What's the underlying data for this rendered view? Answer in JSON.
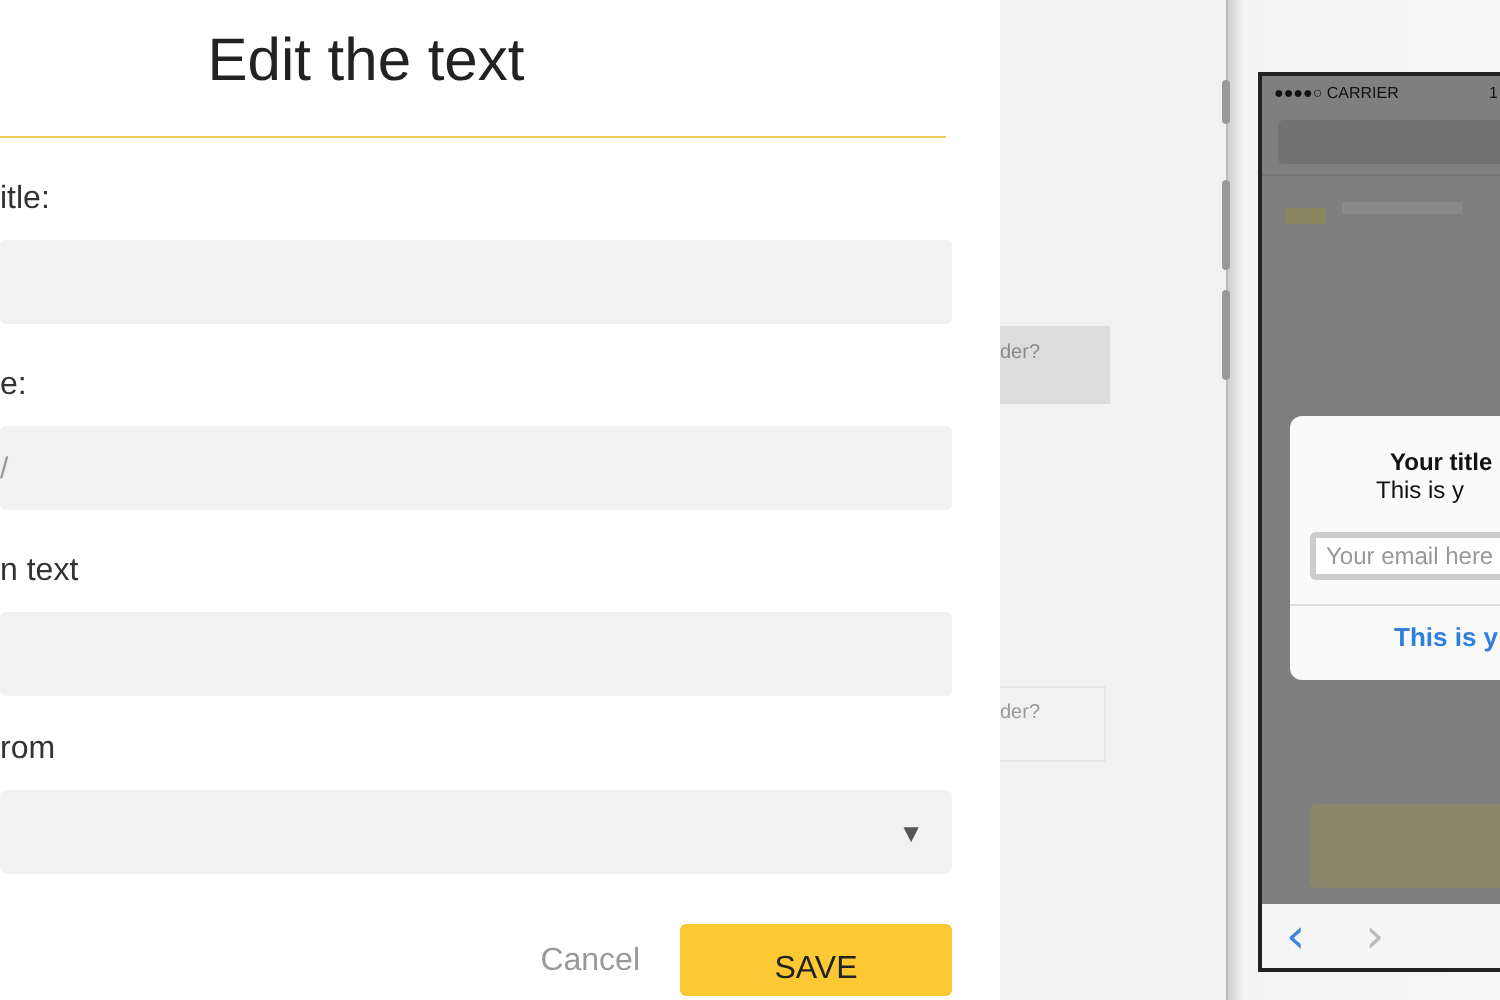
{
  "dialog": {
    "title": "Edit the text",
    "fields": [
      {
        "kind": "input",
        "label": "itle:"
      },
      {
        "kind": "input",
        "label": "e:",
        "placeholder": "/"
      },
      {
        "kind": "input",
        "label": "n text"
      },
      {
        "kind": "select",
        "label": "rom",
        "arrow": "▼"
      }
    ],
    "buttons": [
      {
        "kind": "link",
        "label": "Cancel"
      },
      {
        "kind": "primary",
        "label": "SAVE"
      }
    ]
  },
  "background": {
    "hints": [
      "der?",
      "der?"
    ]
  },
  "phone": {
    "carrier": "●●●●○ CARRIER",
    "time": "1",
    "alert": {
      "title": "Your title",
      "message": "This is y",
      "placeholder": "Your email here",
      "action": "This is y"
    },
    "toolbar": [
      "‹",
      "›"
    ]
  }
}
